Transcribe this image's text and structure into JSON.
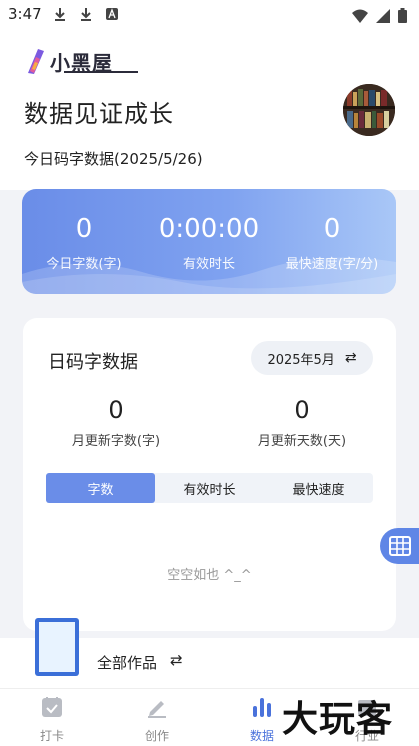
{
  "status_bar": {
    "time": "3:47"
  },
  "brand": {
    "name": "小黑屋"
  },
  "header": {
    "title": "数据见证成长",
    "subtitle": "今日码字数据(2025/5/26)"
  },
  "today_stats": [
    {
      "value": "0",
      "label": "今日字数(字)"
    },
    {
      "value": "0:00:00",
      "label": "有效时长"
    },
    {
      "value": "0",
      "label": "最快速度(字/分)"
    }
  ],
  "daily_card": {
    "title": "日码字数据",
    "month": "2025年5月",
    "switch_icon": "⇄",
    "month_stats": [
      {
        "value": "0",
        "label": "月更新字数(字)"
      },
      {
        "value": "0",
        "label": "月更新天数(天)"
      }
    ],
    "tabs": [
      "字数",
      "有效时长",
      "最快速度"
    ],
    "active_tab": 0,
    "empty_text": "空空如也 ^_^"
  },
  "works_bar": {
    "label": "全部作品",
    "switch_icon": "⇄"
  },
  "tabbar": {
    "items": [
      {
        "label": "打卡",
        "icon": "checkin-icon"
      },
      {
        "label": "创作",
        "icon": "pen-icon"
      },
      {
        "label": "数据",
        "icon": "bar-chart-icon"
      },
      {
        "label": "行业",
        "icon": "industry-icon"
      }
    ],
    "active_index": 2
  },
  "watermark": "大玩客",
  "colors": {
    "accent": "#6a8de8",
    "accent_active_text": "#4a72db",
    "background": "#f2f3f7"
  }
}
